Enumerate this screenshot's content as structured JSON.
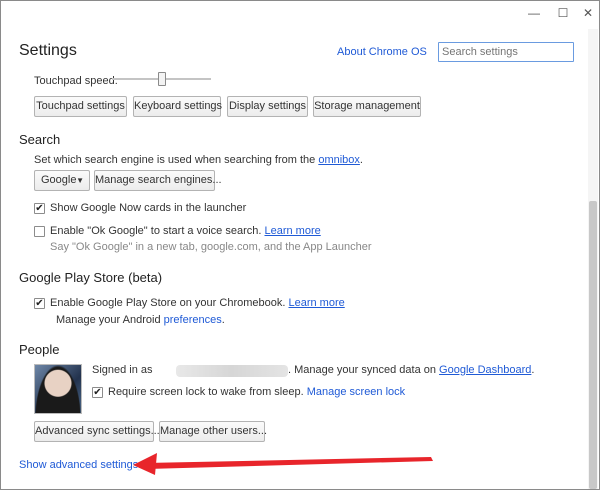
{
  "window": {
    "minimize_glyph": "—",
    "maximize_glyph": "☐",
    "close_glyph": "✕"
  },
  "header": {
    "title": "Settings",
    "about_link": "About Chrome OS",
    "search_placeholder": "Search settings"
  },
  "device": {
    "touchpad_speed_label": "Touchpad speed:",
    "buttons": [
      "Touchpad settings",
      "Keyboard settings",
      "Display settings",
      "Storage management"
    ]
  },
  "search_section": {
    "title": "Search",
    "description": "Set which search engine is used when searching from the ",
    "omnibox_link": "omnibox",
    "description_end": ".",
    "engine_selected": "Google",
    "manage_button": "Manage search engines...",
    "google_now_label": "Show Google Now cards in the launcher",
    "ok_google_label": "Enable \"Ok Google\" to start a voice search.",
    "ok_google_learn_more": "Learn more",
    "ok_google_hint": "Say \"Ok Google\" in a new tab, google.com, and the App Launcher"
  },
  "play_store": {
    "title": "Google Play Store (beta)",
    "enable_label": "Enable Google Play Store on your Chromebook.",
    "learn_more": "Learn more",
    "manage_text": "Manage your Android ",
    "preferences_link": "preferences",
    "manage_end": "."
  },
  "people": {
    "title": "People",
    "signed_in_prefix": "Signed in as",
    "synced_text": ". Manage your synced data on ",
    "dashboard_link": "Google Dashboard",
    "synced_end": ".",
    "screen_lock_label": "Require screen lock to wake from sleep.",
    "manage_screen_lock": "Manage screen lock",
    "buttons": [
      "Advanced sync settings...",
      "Manage other users..."
    ]
  },
  "footer": {
    "show_advanced": "Show advanced settings..."
  },
  "checkboxes": {
    "google_now": true,
    "ok_google": false,
    "play_store": true,
    "screen_lock": true
  },
  "colors": {
    "link": "#1f5ad6",
    "annotation_arrow": "#e8252b",
    "focus_border": "#6a9be0"
  },
  "icons": {
    "dropdown": "triangle-down",
    "check": "checkmark"
  }
}
